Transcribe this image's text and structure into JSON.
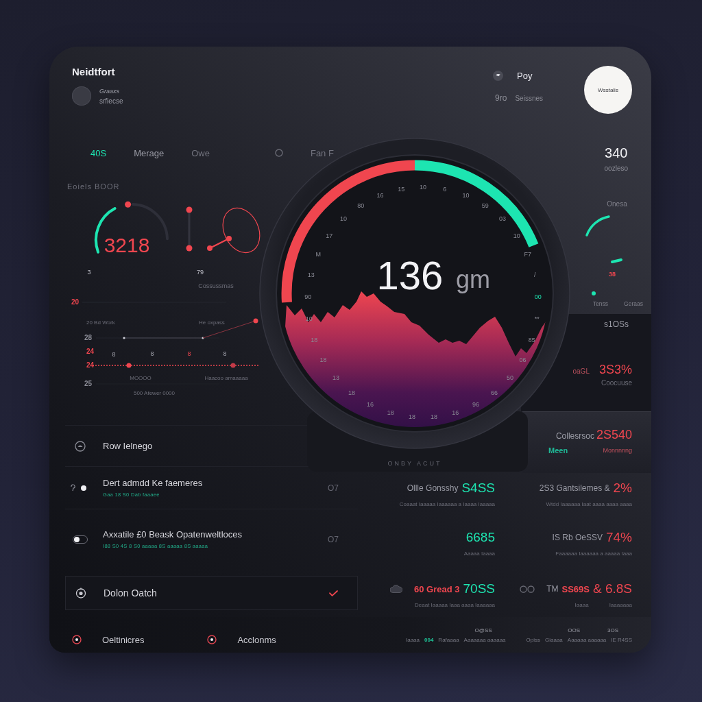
{
  "header": {
    "title": "Neidtfort",
    "user": {
      "name": "Graaxs",
      "role": "srfiecse"
    },
    "status": {
      "label": "Poy",
      "code": "9ro",
      "caption": "Seissnes"
    },
    "badge": "Wsstalis"
  },
  "tabs": [
    {
      "label": "40S",
      "selected": true,
      "disabled": false
    },
    {
      "label": "Merage",
      "selected": false,
      "disabled": false
    },
    {
      "label": "Owe",
      "selected": false,
      "disabled": true
    },
    {
      "label": "Fan F",
      "selected": false,
      "disabled": true
    }
  ],
  "headline": {
    "value": "340",
    "caption": "oozleso"
  },
  "overview": {
    "title": "Eoiels BOOR",
    "value": "3218",
    "ticks": [
      "3",
      "79"
    ],
    "caption": "Cossussmas"
  },
  "trend": {
    "axis_labels": [
      {
        "text": "20",
        "highlight": true
      },
      {
        "text": "28",
        "highlight": false
      },
      {
        "text": "24",
        "highlight": true
      },
      {
        "text": "24",
        "highlight": true
      },
      {
        "text": "25",
        "highlight": false
      }
    ],
    "series_labels": [
      "20 Bd Work",
      "He oxpass"
    ],
    "point_labels": [
      {
        "text": "8",
        "highlight": false
      },
      {
        "text": "8",
        "highlight": false
      },
      {
        "text": "8",
        "highlight": true
      },
      {
        "text": "8",
        "highlight": false
      }
    ],
    "footer_labels": [
      "MOOOO",
      "Haacoo amaaaaa",
      "500 Afewer 0000"
    ]
  },
  "gauge": {
    "value": "136",
    "unit": "gm",
    "dial_labels_right": [
      {
        "text": "10",
        "highlight": false
      },
      {
        "text": "6",
        "highlight": false
      },
      {
        "text": "10",
        "highlight": false
      },
      {
        "text": "59",
        "highlight": false
      },
      {
        "text": "03",
        "highlight": false
      },
      {
        "text": "10",
        "highlight": false
      },
      {
        "text": "F7",
        "highlight": false
      },
      {
        "text": "/",
        "highlight": false
      },
      {
        "text": "00",
        "highlight": true
      },
      {
        "text": "**",
        "highlight": false
      },
      {
        "text": "85",
        "highlight": false
      },
      {
        "text": "06",
        "highlight": false
      },
      {
        "text": "50",
        "highlight": false
      },
      {
        "text": "66",
        "highlight": false
      },
      {
        "text": "96",
        "highlight": false
      },
      {
        "text": "16",
        "highlight": false
      },
      {
        "text": "18",
        "highlight": false
      }
    ],
    "dial_labels_left": [
      {
        "text": "15",
        "highlight": false
      },
      {
        "text": "16",
        "highlight": false
      },
      {
        "text": "80",
        "highlight": false
      },
      {
        "text": "10",
        "highlight": false
      },
      {
        "text": "17",
        "highlight": false
      },
      {
        "text": "M",
        "highlight": false
      },
      {
        "text": "13",
        "highlight": false
      },
      {
        "text": "90",
        "highlight": false
      },
      {
        "text": "10",
        "highlight": false
      },
      {
        "text": "18",
        "highlight": false
      },
      {
        "text": "18",
        "highlight": false
      },
      {
        "text": "13",
        "highlight": false
      },
      {
        "text": "18",
        "highlight": false
      },
      {
        "text": "16",
        "highlight": false
      },
      {
        "text": "18",
        "highlight": false
      },
      {
        "text": "18",
        "highlight": false
      }
    ],
    "base_caption": "ONBY ACUT"
  },
  "side": {
    "title": "Onesa",
    "value": "38",
    "captions": [
      "Tenss",
      "Geraas"
    ]
  },
  "side_panel": {
    "title": "s1OSs",
    "prefix": "oaGL",
    "value": "3S3%",
    "caption": "Coocuuse"
  },
  "summary": {
    "label": "Collesrsoc",
    "value": "2S540",
    "tag": "Meen",
    "note": "Monnnnng"
  },
  "list": [
    {
      "kind": "plain",
      "title": "Row Ielnego"
    },
    {
      "kind": "detail",
      "title": "Dert admdd Ke faemeres",
      "subtitle": "Gaa 18 S0 Dab faaaee",
      "trail": "O7"
    },
    {
      "kind": "toggle",
      "title": "Axxatile £0 Beask Opatenweltloces",
      "subtitle": "I88 S0 4S 8 S0 aaaaa 8S aaaaa 8S aaaaa",
      "trail": "O7",
      "on": false
    },
    {
      "kind": "check",
      "title": "Dolon Oatch",
      "checked": true
    }
  ],
  "stats": [
    {
      "kind": "plain",
      "parts": [
        {
          "text": "Ollle Gonsshy"
        },
        {
          "text": "S4SS",
          "color": "#1de5b1"
        }
      ],
      "captions": [
        "Coaaat Iaaaaa Iaaaaaa a Iaaaa Iaaaaa"
      ]
    },
    {
      "kind": "plain",
      "parts": [
        {
          "text": "2S3 Gantsilemes &"
        },
        {
          "text": "2%",
          "color": "#f0464f"
        }
      ],
      "captions": [
        "Wtdd Iaaaaaa Iaat aaaa aaaa aaaa"
      ]
    },
    {
      "kind": "plain",
      "parts": [
        {
          "text": "6685",
          "color": "#1de5b1"
        }
      ],
      "captions": [
        "Aaaaa Iaaaa"
      ]
    },
    {
      "kind": "plain",
      "parts": [
        {
          "text": "IS Rb OeSSV"
        },
        {
          "text": "74%",
          "color": "#f0464f"
        }
      ],
      "captions": [
        "Faaaaaa Iaaaaaa a aaaaa Iaaa"
      ]
    },
    {
      "kind": "cloud",
      "parts": [
        {
          "text": "60 Gread 3",
          "color": "#f0464f"
        },
        {
          "text": "70SS",
          "color": "#1de5b1"
        }
      ],
      "captions": [
        "Deaat Iaaaaa Iaaa aaaa Iaaaaaa"
      ]
    },
    {
      "kind": "rings",
      "parts": [
        {
          "text": "TM"
        },
        {
          "text": "SS69S",
          "color": "#f0464f"
        },
        {
          "text": "& 6.8S",
          "color": "#f0464f"
        }
      ],
      "captions": [
        "Iaaaa",
        "Iaaaaaaa"
      ]
    }
  ],
  "footer": {
    "links": [
      "Oeltinicres",
      "Acclonms"
    ],
    "groups": [
      {
        "headings": [
          "O@SS"
        ],
        "items": [
          {
            "text": "Iaaaa",
            "highlight": false
          },
          {
            "text": "004",
            "highlight": true
          },
          {
            "text": "Rafaaaa",
            "highlight": false
          },
          {
            "text": "Aaaaaaa aaaaaa",
            "highlight": false
          }
        ]
      },
      {
        "headings": [
          "OOS",
          "3OS"
        ],
        "items": [
          {
            "text": "Opiss",
            "highlight": false
          },
          {
            "text": "Giaaaa",
            "highlight": false
          },
          {
            "text": "Aaaaaa aaaaaa",
            "highlight": false
          },
          {
            "text": "IE R4SS",
            "highlight": false
          }
        ]
      }
    ]
  }
}
